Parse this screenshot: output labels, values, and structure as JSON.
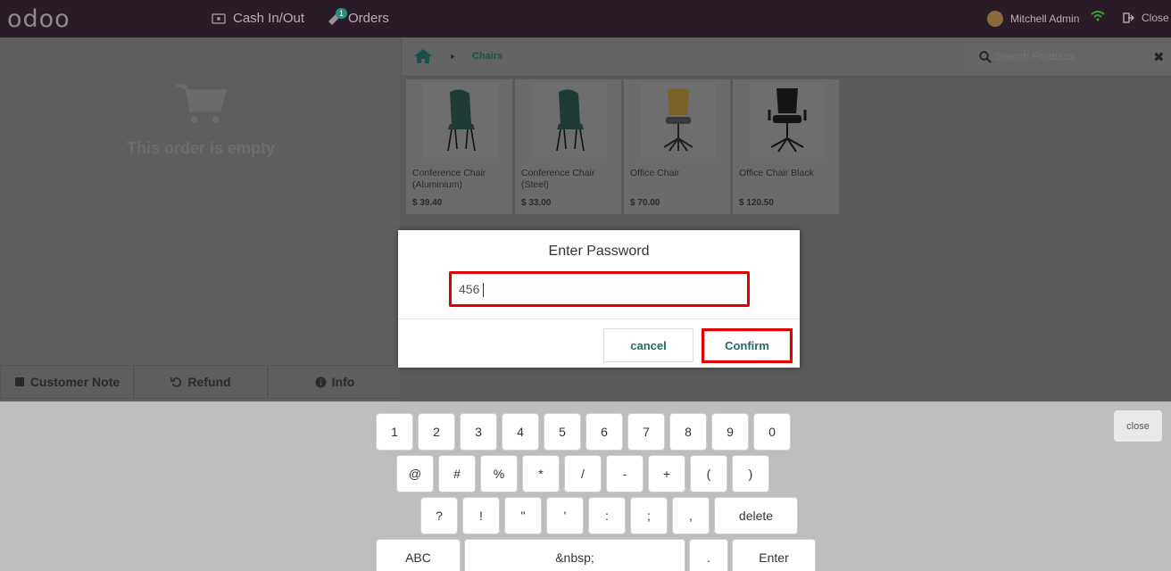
{
  "topbar": {
    "logo": "odoo",
    "cash_label": "Cash In/Out",
    "orders_label": "Orders",
    "orders_badge": "1",
    "user_name": "Mitchell Admin",
    "close_label": "Close"
  },
  "left": {
    "empty_text": "This order is empty",
    "controls": [
      "Customer Note",
      "Refund",
      "Info"
    ]
  },
  "right": {
    "breadcrumb": "Chairs",
    "search_placeholder": "Search Products...",
    "products": [
      {
        "name": "Conference Chair (Aluminium)",
        "price": "$ 39.40"
      },
      {
        "name": "Conference Chair (Steel)",
        "price": "$ 33.00"
      },
      {
        "name": "Office Chair",
        "price": "$ 70.00"
      },
      {
        "name": "Office Chair Black",
        "price": "$ 120.50"
      }
    ]
  },
  "modal": {
    "title": "Enter Password",
    "password_value": "456",
    "cancel_label": "cancel",
    "confirm_label": "Confirm"
  },
  "keyboard": {
    "close_label": "close",
    "row1": [
      "1",
      "2",
      "3",
      "4",
      "5",
      "6",
      "7",
      "8",
      "9",
      "0"
    ],
    "row2": [
      "@",
      "#",
      "%",
      "*",
      "/",
      "-",
      "+",
      "(",
      ")"
    ],
    "row3": [
      "?",
      "!",
      "\"",
      "'",
      ":",
      ";",
      ",",
      "delete"
    ],
    "row4": [
      "ABC",
      "&nbsp;",
      ".",
      "Enter"
    ]
  },
  "colors": {
    "topbar": "#2a1c26",
    "accent": "#1f6d67",
    "highlight": "#e10000",
    "keyboard_bg": "#bdbdbd"
  }
}
